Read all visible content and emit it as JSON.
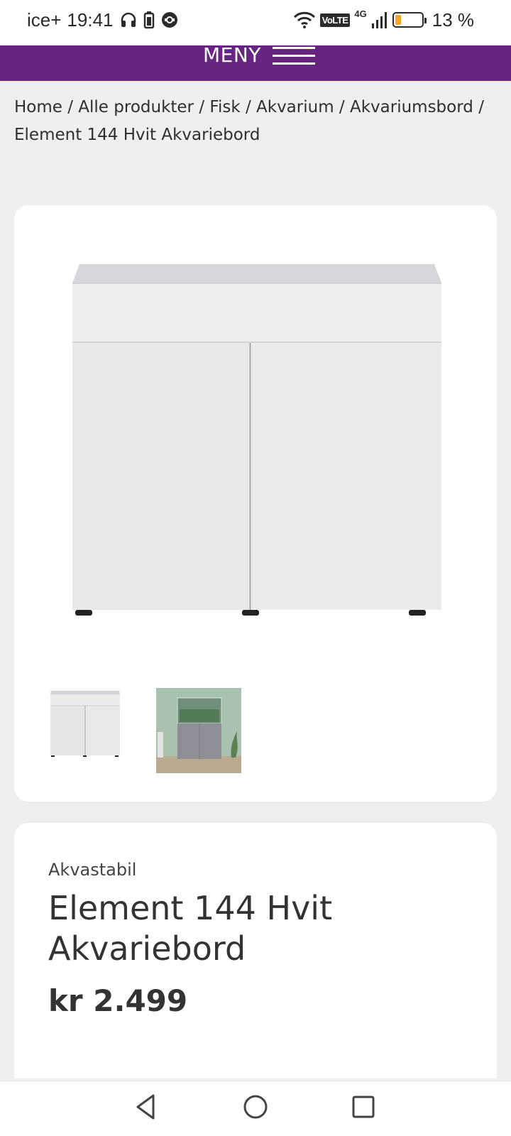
{
  "status_bar": {
    "carrier": "ice+",
    "time": "19:41",
    "volte": "VoLTE",
    "network": "4G",
    "battery_percent": "13 %",
    "battery_level": 0.13,
    "icons": [
      "headphones-icon",
      "battery-saver-icon",
      "sync-icon",
      "wifi-icon",
      "signal-icon",
      "battery-icon"
    ]
  },
  "header": {
    "menu_label": "MENY"
  },
  "breadcrumb": {
    "items": [
      "Home",
      "Alle produkter",
      "Fisk",
      "Akvarium",
      "Akvariumsbord",
      "Element 144 Hvit Akvariebord"
    ],
    "separator": " / "
  },
  "gallery": {
    "main_image": "white-two-door-aquarium-cabinet",
    "thumbnails": [
      "white-cabinet-thumbnail",
      "cabinet-with-aquarium-room-thumbnail"
    ]
  },
  "product": {
    "brand": "Akvastabil",
    "title": "Element 144 Hvit Akvariebord",
    "price": "kr 2.499"
  },
  "colors": {
    "brand_purple": "#652580",
    "page_bg": "#efefef",
    "card_bg": "#ffffff",
    "battery_low": "#f5a623"
  }
}
